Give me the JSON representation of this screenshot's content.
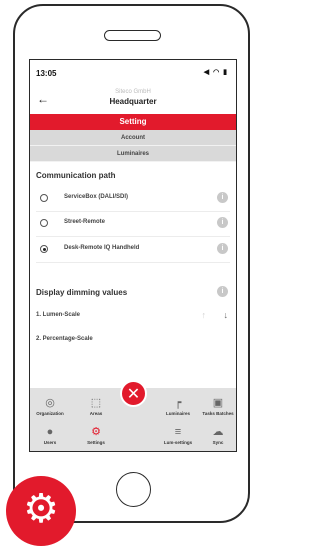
{
  "status": {
    "time": "13:05",
    "icons": "◀ ◠ ▮"
  },
  "header": {
    "company": "Siteco GmbH",
    "location": "Headquarter"
  },
  "tabs": [
    {
      "label": "Setting",
      "active": true
    },
    {
      "label": "Account",
      "active": false
    },
    {
      "label": "Luminaires",
      "active": false
    }
  ],
  "communication": {
    "title": "Communication path",
    "options": [
      {
        "label": "ServiceBox (DALI/SDI)",
        "selected": false
      },
      {
        "label": "Street-Remote",
        "selected": false
      },
      {
        "label": "Desk-Remote IQ Handheld",
        "selected": true
      }
    ]
  },
  "dimming": {
    "title": "Display dimming values",
    "items": [
      {
        "label": "1. Lumen-Scale"
      },
      {
        "label": "2. Percentage-Scale"
      }
    ]
  },
  "menu": {
    "row1": [
      {
        "label": "Organization",
        "icon": "target-icon"
      },
      {
        "label": "Areas",
        "icon": "area-icon"
      },
      {
        "label": "Luminaires",
        "icon": "luminaire-icon"
      },
      {
        "label": "Tasks Batches",
        "icon": "briefcase-icon"
      }
    ],
    "row2": [
      {
        "label": "Users",
        "icon": "user-icon"
      },
      {
        "label": "Settings",
        "icon": "gear-icon"
      },
      {
        "label": "Lum-settings",
        "icon": "list-settings-icon"
      },
      {
        "label": "Sync",
        "icon": "cloud-check-icon"
      }
    ]
  },
  "colors": {
    "accent": "#e21a2c",
    "menu_bg": "#e1e1e1",
    "tab_gray": "#d9d9d9"
  }
}
